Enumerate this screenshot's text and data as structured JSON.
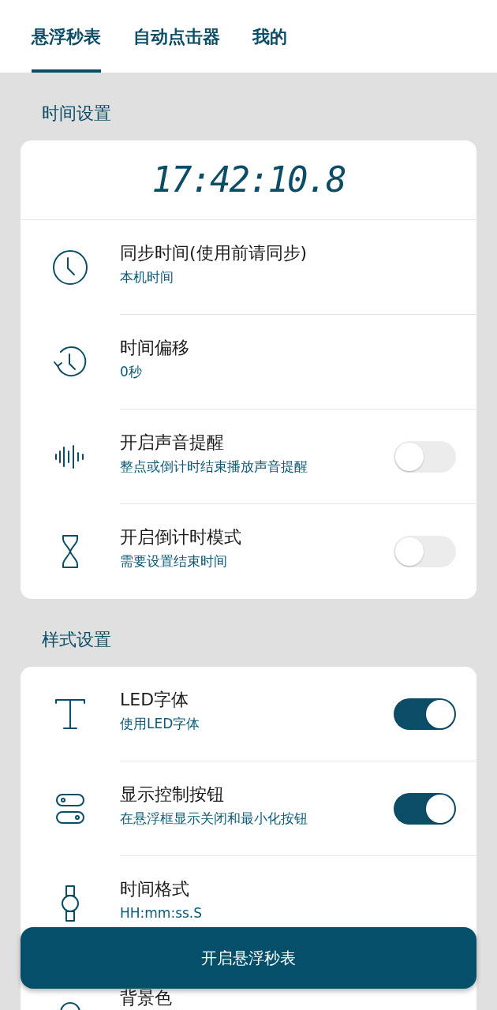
{
  "tabs": [
    {
      "label": "悬浮秒表",
      "selected": true
    },
    {
      "label": "自动点击器",
      "selected": false
    },
    {
      "label": "我的",
      "selected": false
    }
  ],
  "sections": [
    {
      "title": "时间设置",
      "clock": "17:42:10.8",
      "rows": [
        {
          "kind": "nav",
          "title": "同步时间(使用前请同步)",
          "subtitle": "本机时间"
        },
        {
          "kind": "nav",
          "title": "时间偏移",
          "subtitle": "0秒"
        },
        {
          "kind": "toggle",
          "title": "开启声音提醒",
          "subtitle": "整点或倒计时结束播放声音提醒",
          "on": false
        },
        {
          "kind": "toggle",
          "title": "开启倒计时模式",
          "subtitle": "需要设置结束时间",
          "on": false
        }
      ]
    },
    {
      "title": "样式设置",
      "rows": [
        {
          "kind": "toggle",
          "title": "LED字体",
          "subtitle": "使用LED字体",
          "on": true
        },
        {
          "kind": "toggle",
          "title": "显示控制按钮",
          "subtitle": "在悬浮框显示关闭和最小化按钮",
          "on": true
        },
        {
          "kind": "nav",
          "title": "时间格式",
          "subtitle": "HH:mm:ss.S"
        },
        {
          "kind": "nav",
          "title": "背景色"
        }
      ]
    }
  ],
  "action_button": "开启悬浮秒表"
}
